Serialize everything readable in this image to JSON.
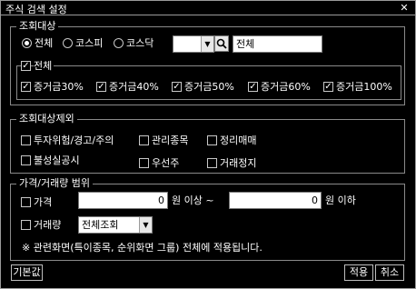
{
  "window": {
    "title": "주식 검색 설정",
    "close_glyph": "✕"
  },
  "target": {
    "legend": "조회대상",
    "radios": [
      {
        "label": "전체",
        "selected": true
      },
      {
        "label": "코스피",
        "selected": false
      },
      {
        "label": "코스닥",
        "selected": false
      }
    ],
    "code_value": "",
    "name_value": "전체",
    "all_group": {
      "label": "전체",
      "checked": true,
      "items": [
        {
          "label": "증거금30%",
          "checked": true
        },
        {
          "label": "증거금40%",
          "checked": true
        },
        {
          "label": "증거금50%",
          "checked": true
        },
        {
          "label": "증거금60%",
          "checked": true
        },
        {
          "label": "증거금100%",
          "checked": true
        }
      ]
    }
  },
  "exclude": {
    "legend": "조회대상제외",
    "items": [
      {
        "label": "투자위험/경고/주의",
        "checked": false
      },
      {
        "label": "관리종목",
        "checked": false
      },
      {
        "label": "정리매매",
        "checked": false
      },
      {
        "label": "불성실공시",
        "checked": false
      },
      {
        "label": "우선주",
        "checked": false
      },
      {
        "label": "거래정지",
        "checked": false
      }
    ]
  },
  "range": {
    "legend": "가격/거래량 범위",
    "price_label": "가격",
    "price_checked": false,
    "price_min": "0",
    "unit_above": "원 이상 ~",
    "price_max": "0",
    "unit_below": "원 이하",
    "volume_label": "거래량",
    "volume_checked": false,
    "volume_select": "전체조회",
    "note": "※ 관련화면(특이종목, 순위화면 그룹) 전체에 적용됩니다."
  },
  "footer": {
    "default_label": "기본값",
    "apply_label": "적용",
    "cancel_label": "취소"
  },
  "icons": {
    "checkmark": "✓",
    "dropdown": "▼",
    "search": "search-icon"
  }
}
